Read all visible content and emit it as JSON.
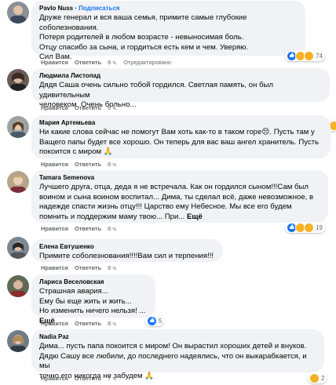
{
  "labels": {
    "like": "Нравится",
    "reply": "Ответить",
    "edited": "Отредактировано",
    "see_more": "Ещё"
  },
  "comments": [
    {
      "author": "Pavlo Nuss",
      "follow": "Подписаться",
      "text": "Друже генерал и вся ваша семья, примите самые глубокие соболезнования.\nПотеря родителей в любом возрасте - невыносимая боль.\nОтцу спасибо за сына, и гордиться есть кем и чем. Уверяю.\nСил Вам.",
      "time": "8 ч.",
      "reactions": {
        "icons": [
          "like",
          "sad",
          "care"
        ],
        "count": "74"
      }
    },
    {
      "author": "Людмила Листопад",
      "text": "Дядя Саша очень сильно тобой гордился. Светлая память, он был удивительным\nчеловеком. Очень больно...",
      "time": "8 ч.",
      "reactions": {
        "icons": [
          "like",
          "sad",
          "care"
        ],
        "count": ""
      }
    },
    {
      "author": "Мария Артемьева",
      "text": "Ни какие слова сейчас не помогут Вам хоть как-то в таком горе😔. Пусть там у\nВащего папы будет все хорошо. Он теперь для вас ваш ангел хранитель. Пусть\nпокоится с миром 🙏",
      "time": "8 ч.",
      "reactions": {
        "icons": [],
        "count": ""
      }
    },
    {
      "author": "Tamara Semenova",
      "text": "Лучшего друга, отца, деда я не встречала. Как он гордился сыном!!!Сам был\nвоином и сына воином воспитал... Дима, ты сделал всё, даже невозможное, в\nнадежде спасти жизнь отцу!!! Царство ему Небесное. Мы все его будем\nпомнить и поддержим маму твою... При...",
      "time": "8 ч.",
      "reactions": {
        "icons": [
          "like",
          "sad",
          "care"
        ],
        "count": "19"
      }
    },
    {
      "author": "Елена Евтушенко",
      "text": "Примите соболезнования!!!!Вам сил и терпения!!!",
      "time": "8 ч.",
      "reactions": {
        "icons": [],
        "count": ""
      }
    },
    {
      "author": "Лариса Веселовская",
      "text": "Страшная авария...\nЕму бы еще жить и жить...\nНо изменить ничего нельзя! ...",
      "time": "8 ч.",
      "reactions": {
        "icons": [
          "like"
        ],
        "count": "5"
      }
    },
    {
      "author": "Nadia Paz",
      "text": "Дима... пусть папа покоится с миром! Он вырастил хороших детей и внуков.\nДядю Сашу все любили, до последнего надеялись, что он выкарабкается, и мы\nточно его никогда не забудем 🙏",
      "time": "7 ч.",
      "reactions": {
        "icons": [
          "sad"
        ],
        "count": "2"
      }
    }
  ]
}
